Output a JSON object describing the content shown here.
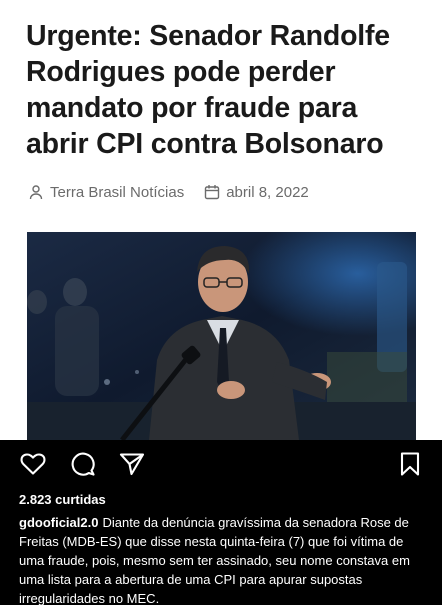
{
  "article": {
    "headline": "Urgente: Senador Randolfe Rodrigues pode perder mandato por fraude para abrir CPI contra Bolsonaro",
    "author": "Terra Brasil Notícias",
    "date": "abril 8, 2022",
    "author_icon": "user-icon",
    "date_icon": "calendar-icon"
  },
  "post": {
    "icons": [
      "heart-icon",
      "comment-icon",
      "share-icon",
      "bookmark-icon"
    ],
    "likes": "2.823 curtidas",
    "username": "gdooficial2.0",
    "caption": "Diante da denúncia gravíssima da senadora Rose de Freitas (MDB-ES) que disse nesta quinta-feira (7) que foi vítima de uma fraude, pois, mesmo sem ter assinado, seu nome constava em uma lista para a abertura de uma CPI para apurar supostas irregularidades no MEC."
  }
}
